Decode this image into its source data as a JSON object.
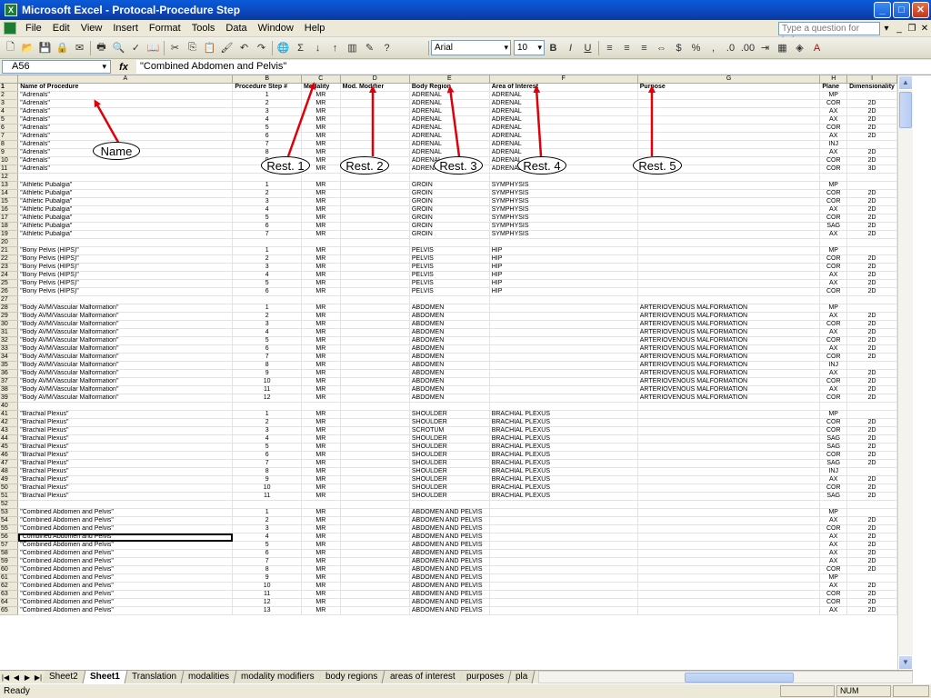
{
  "window": {
    "title": "Microsoft Excel - Protocal-Procedure Step",
    "app_icon": "X"
  },
  "menu": {
    "items": [
      "File",
      "Edit",
      "View",
      "Insert",
      "Format",
      "Tools",
      "Data",
      "Window",
      "Help"
    ],
    "help_placeholder": "Type a question for help"
  },
  "toolbar": {
    "font_name": "Arial",
    "font_size": "10",
    "zoom_sep": "$",
    "percent": "%",
    "comma": ","
  },
  "formula": {
    "cell_ref": "A56",
    "fx": "fx",
    "content": "\"Combined Abdomen and Pelvis\""
  },
  "columns": [
    "A",
    "B",
    "C",
    "D",
    "E",
    "F",
    "G",
    "H",
    "I"
  ],
  "header_row": {
    "num": "1",
    "cells": [
      "Name of Procedure",
      "Procedure Step #",
      "Modality",
      "Mod. Modifier",
      "Body Region",
      "Area of Interest",
      "Purpose",
      "Plane",
      "Dimensionality"
    ]
  },
  "rows": [
    [
      "2",
      "\"Adrenals\"",
      "1",
      "MR",
      "",
      "ADRENAL",
      "ADRENAL",
      "",
      "MP",
      ""
    ],
    [
      "3",
      "\"Adrenals\"",
      "2",
      "MR",
      "",
      "ADRENAL",
      "ADRENAL",
      "",
      "COR",
      "2D"
    ],
    [
      "4",
      "\"Adrenals\"",
      "3",
      "MR",
      "",
      "ADRENAL",
      "ADRENAL",
      "",
      "AX",
      "2D"
    ],
    [
      "5",
      "\"Adrenals\"",
      "4",
      "MR",
      "",
      "ADRENAL",
      "ADRENAL",
      "",
      "AX",
      "2D"
    ],
    [
      "6",
      "\"Adrenals\"",
      "5",
      "MR",
      "",
      "ADRENAL",
      "ADRENAL",
      "",
      "COR",
      "2D"
    ],
    [
      "7",
      "\"Adrenals\"",
      "6",
      "MR",
      "",
      "ADRENAL",
      "ADRENAL",
      "",
      "AX",
      "2D"
    ],
    [
      "8",
      "\"Adrenals\"",
      "7",
      "MR",
      "",
      "ADRENAL",
      "ADRENAL",
      "",
      "INJ",
      ""
    ],
    [
      "9",
      "\"Adrenals\"",
      "8",
      "MR",
      "",
      "ADRENAL",
      "ADRENAL",
      "",
      "AX",
      "2D"
    ],
    [
      "10",
      "\"Adrenals\"",
      "9",
      "MR",
      "",
      "ADRENAL",
      "ADRENAL",
      "",
      "COR",
      "2D"
    ],
    [
      "11",
      "\"Adrenals\"",
      "10",
      "MR",
      "",
      "ADRENAL",
      "ADRENAL",
      "",
      "COR",
      "3D"
    ],
    [
      "12",
      "",
      "",
      "",
      "",
      "",
      "",
      "",
      "",
      ""
    ],
    [
      "13",
      "\"Athletic Pubalgia\"",
      "1",
      "MR",
      "",
      "GROIN",
      "SYMPHYSIS",
      "",
      "MP",
      ""
    ],
    [
      "14",
      "\"Athletic Pubalgia\"",
      "2",
      "MR",
      "",
      "GROIN",
      "SYMPHYSIS",
      "",
      "COR",
      "2D"
    ],
    [
      "15",
      "\"Athletic Pubalgia\"",
      "3",
      "MR",
      "",
      "GROIN",
      "SYMPHYSIS",
      "",
      "COR",
      "2D"
    ],
    [
      "16",
      "\"Athletic Pubalgia\"",
      "4",
      "MR",
      "",
      "GROIN",
      "SYMPHYSIS",
      "",
      "AX",
      "2D"
    ],
    [
      "17",
      "\"Athletic Pubalgia\"",
      "5",
      "MR",
      "",
      "GROIN",
      "SYMPHYSIS",
      "",
      "COR",
      "2D"
    ],
    [
      "18",
      "\"Athletic Pubalgia\"",
      "6",
      "MR",
      "",
      "GROIN",
      "SYMPHYSIS",
      "",
      "SAG",
      "2D"
    ],
    [
      "19",
      "\"Athletic Pubalgia\"",
      "7",
      "MR",
      "",
      "GROIN",
      "SYMPHYSIS",
      "",
      "AX",
      "2D"
    ],
    [
      "20",
      "",
      "",
      "",
      "",
      "",
      "",
      "",
      "",
      ""
    ],
    [
      "21",
      "\"Bony Pelvis (HIPS)\"",
      "1",
      "MR",
      "",
      "PELVIS",
      "HIP",
      "",
      "MP",
      ""
    ],
    [
      "22",
      "\"Bony Pelvis (HIPS)\"",
      "2",
      "MR",
      "",
      "PELVIS",
      "HIP",
      "",
      "COR",
      "2D"
    ],
    [
      "23",
      "\"Bony Pelvis (HIPS)\"",
      "3",
      "MR",
      "",
      "PELVIS",
      "HIP",
      "",
      "COR",
      "2D"
    ],
    [
      "24",
      "\"Bony Pelvis (HIPS)\"",
      "4",
      "MR",
      "",
      "PELVIS",
      "HIP",
      "",
      "AX",
      "2D"
    ],
    [
      "25",
      "\"Bony Pelvis (HIPS)\"",
      "5",
      "MR",
      "",
      "PELVIS",
      "HIP",
      "",
      "AX",
      "2D"
    ],
    [
      "26",
      "\"Bony Pelvis (HIPS)\"",
      "6",
      "MR",
      "",
      "PELVIS",
      "HIP",
      "",
      "COR",
      "2D"
    ],
    [
      "27",
      "",
      "",
      "",
      "",
      "",
      "",
      "",
      "",
      ""
    ],
    [
      "28",
      "\"Body AVM/Vascular Malformation\"",
      "1",
      "MR",
      "",
      "ABDOMEN",
      "",
      "ARTERIOVENOUS MALFORMATION",
      "MP",
      ""
    ],
    [
      "29",
      "\"Body AVM/Vascular Malformation\"",
      "2",
      "MR",
      "",
      "ABDOMEN",
      "",
      "ARTERIOVENOUS MALFORMATION",
      "AX",
      "2D"
    ],
    [
      "30",
      "\"Body AVM/Vascular Malformation\"",
      "3",
      "MR",
      "",
      "ABDOMEN",
      "",
      "ARTERIOVENOUS MALFORMATION",
      "COR",
      "2D"
    ],
    [
      "31",
      "\"Body AVM/Vascular Malformation\"",
      "4",
      "MR",
      "",
      "ABDOMEN",
      "",
      "ARTERIOVENOUS MALFORMATION",
      "AX",
      "2D"
    ],
    [
      "32",
      "\"Body AVM/Vascular Malformation\"",
      "5",
      "MR",
      "",
      "ABDOMEN",
      "",
      "ARTERIOVENOUS MALFORMATION",
      "COR",
      "2D"
    ],
    [
      "33",
      "\"Body AVM/Vascular Malformation\"",
      "6",
      "MR",
      "",
      "ABDOMEN",
      "",
      "ARTERIOVENOUS MALFORMATION",
      "AX",
      "2D"
    ],
    [
      "34",
      "\"Body AVM/Vascular Malformation\"",
      "7",
      "MR",
      "",
      "ABDOMEN",
      "",
      "ARTERIOVENOUS MALFORMATION",
      "COR",
      "2D"
    ],
    [
      "35",
      "\"Body AVM/Vascular Malformation\"",
      "8",
      "MR",
      "",
      "ABDOMEN",
      "",
      "ARTERIOVENOUS MALFORMATION",
      "INJ",
      ""
    ],
    [
      "36",
      "\"Body AVM/Vascular Malformation\"",
      "9",
      "MR",
      "",
      "ABDOMEN",
      "",
      "ARTERIOVENOUS MALFORMATION",
      "AX",
      "2D"
    ],
    [
      "37",
      "\"Body AVM/Vascular Malformation\"",
      "10",
      "MR",
      "",
      "ABDOMEN",
      "",
      "ARTERIOVENOUS MALFORMATION",
      "COR",
      "2D"
    ],
    [
      "38",
      "\"Body AVM/Vascular Malformation\"",
      "11",
      "MR",
      "",
      "ABDOMEN",
      "",
      "ARTERIOVENOUS MALFORMATION",
      "AX",
      "2D"
    ],
    [
      "39",
      "\"Body AVM/Vascular Malformation\"",
      "12",
      "MR",
      "",
      "ABDOMEN",
      "",
      "ARTERIOVENOUS MALFORMATION",
      "COR",
      "2D"
    ],
    [
      "40",
      "",
      "",
      "",
      "",
      "",
      "",
      "",
      "",
      ""
    ],
    [
      "41",
      "\"Brachial Plexus\"",
      "1",
      "MR",
      "",
      "SHOULDER",
      "BRACHIAL PLEXUS",
      "",
      "MP",
      ""
    ],
    [
      "42",
      "\"Brachial Plexus\"",
      "2",
      "MR",
      "",
      "SHOULDER",
      "BRACHIAL PLEXUS",
      "",
      "COR",
      "2D"
    ],
    [
      "43",
      "\"Brachial Plexus\"",
      "3",
      "MR",
      "",
      "SCROTUM",
      "BRACHIAL PLEXUS",
      "",
      "COR",
      "2D"
    ],
    [
      "44",
      "\"Brachial Plexus\"",
      "4",
      "MR",
      "",
      "SHOULDER",
      "BRACHIAL PLEXUS",
      "",
      "SAG",
      "2D"
    ],
    [
      "45",
      "\"Brachial Plexus\"",
      "5",
      "MR",
      "",
      "SHOULDER",
      "BRACHIAL PLEXUS",
      "",
      "SAG",
      "2D"
    ],
    [
      "46",
      "\"Brachial Plexus\"",
      "6",
      "MR",
      "",
      "SHOULDER",
      "BRACHIAL PLEXUS",
      "",
      "COR",
      "2D"
    ],
    [
      "47",
      "\"Brachial Plexus\"",
      "7",
      "MR",
      "",
      "SHOULDER",
      "BRACHIAL PLEXUS",
      "",
      "SAG",
      "2D"
    ],
    [
      "48",
      "\"Brachial Plexus\"",
      "8",
      "MR",
      "",
      "SHOULDER",
      "BRACHIAL PLEXUS",
      "",
      "INJ",
      ""
    ],
    [
      "49",
      "\"Brachial Plexus\"",
      "9",
      "MR",
      "",
      "SHOULDER",
      "BRACHIAL PLEXUS",
      "",
      "AX",
      "2D"
    ],
    [
      "50",
      "\"Brachial Plexus\"",
      "10",
      "MR",
      "",
      "SHOULDER",
      "BRACHIAL PLEXUS",
      "",
      "COR",
      "2D"
    ],
    [
      "51",
      "\"Brachial Plexus\"",
      "11",
      "MR",
      "",
      "SHOULDER",
      "BRACHIAL PLEXUS",
      "",
      "SAG",
      "2D"
    ],
    [
      "52",
      "",
      "",
      "",
      "",
      "",
      "",
      "",
      "",
      ""
    ],
    [
      "53",
      "\"Combined Abdomen and Pelvis\"",
      "1",
      "MR",
      "",
      "ABDOMEN AND PELVIS",
      "",
      "",
      "MP",
      ""
    ],
    [
      "54",
      "\"Combined Abdomen and Pelvis\"",
      "2",
      "MR",
      "",
      "ABDOMEN AND PELVIS",
      "",
      "",
      "AX",
      "2D"
    ],
    [
      "55",
      "\"Combined Abdomen and Pelvis\"",
      "3",
      "MR",
      "",
      "ABDOMEN AND PELVIS",
      "",
      "",
      "COR",
      "2D"
    ],
    [
      "56",
      "\"Combined Abdomen and Pelvis\"",
      "4",
      "MR",
      "",
      "ABDOMEN AND PELVIS",
      "",
      "",
      "AX",
      "2D"
    ],
    [
      "57",
      "\"Combined Abdomen and Pelvis\"",
      "5",
      "MR",
      "",
      "ABDOMEN AND PELVIS",
      "",
      "",
      "AX",
      "2D"
    ],
    [
      "58",
      "\"Combined Abdomen and Pelvis\"",
      "6",
      "MR",
      "",
      "ABDOMEN AND PELVIS",
      "",
      "",
      "AX",
      "2D"
    ],
    [
      "59",
      "\"Combined Abdomen and Pelvis\"",
      "7",
      "MR",
      "",
      "ABDOMEN AND PELVIS",
      "",
      "",
      "AX",
      "2D"
    ],
    [
      "60",
      "\"Combined Abdomen and Pelvis\"",
      "8",
      "MR",
      "",
      "ABDOMEN AND PELVIS",
      "",
      "",
      "COR",
      "2D"
    ],
    [
      "61",
      "\"Combined Abdomen and Pelvis\"",
      "9",
      "MR",
      "",
      "ABDOMEN AND PELVIS",
      "",
      "",
      "MP",
      ""
    ],
    [
      "62",
      "\"Combined Abdomen and Pelvis\"",
      "10",
      "MR",
      "",
      "ABDOMEN AND PELVIS",
      "",
      "",
      "AX",
      "2D"
    ],
    [
      "63",
      "\"Combined Abdomen and Pelvis\"",
      "11",
      "MR",
      "",
      "ABDOMEN AND PELVIS",
      "",
      "",
      "COR",
      "2D"
    ],
    [
      "64",
      "\"Combined Abdomen and Pelvis\"",
      "12",
      "MR",
      "",
      "ABDOMEN AND PELVIS",
      "",
      "",
      "COR",
      "2D"
    ],
    [
      "65",
      "\"Combined Abdomen and Pelvis\"",
      "13",
      "MR",
      "",
      "ABDOMEN AND PELVIS",
      "",
      "",
      "AX",
      "2D"
    ]
  ],
  "selected_row": "56",
  "sheet_tabs": [
    "Sheet2",
    "Sheet1",
    "Translation",
    "modalities",
    "modality modifiers",
    "body regions",
    "areas of interest",
    "purposes",
    "pla"
  ],
  "active_tab": "Sheet1",
  "status": {
    "text": "Ready",
    "num": "NUM"
  },
  "annotations": [
    {
      "label": "Name"
    },
    {
      "label": "Rest. 1"
    },
    {
      "label": "Rest. 2"
    },
    {
      "label": "Rest. 3"
    },
    {
      "label": "Rest. 4"
    },
    {
      "label": "Rest. 5"
    }
  ],
  "annotation_color": "#e0000a"
}
